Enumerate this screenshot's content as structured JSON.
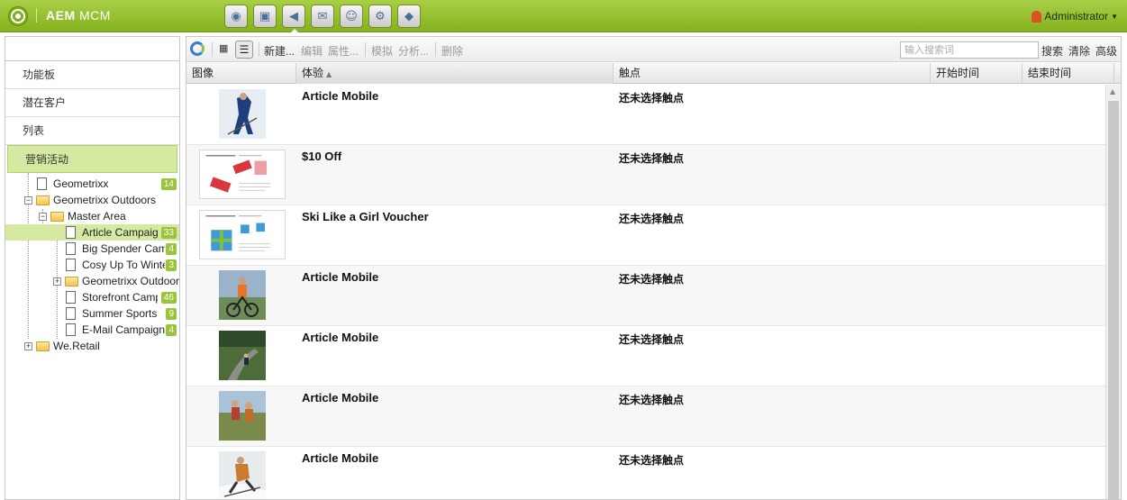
{
  "header": {
    "brand_bold": "AEM",
    "brand_light": "MCM",
    "apps": [
      {
        "name": "globe-icon",
        "glyph": "◉"
      },
      {
        "name": "camera-icon",
        "glyph": "▣"
      },
      {
        "name": "megaphone-icon",
        "glyph": "◀"
      },
      {
        "name": "mail-icon",
        "glyph": "✉"
      },
      {
        "name": "people-icon",
        "glyph": "☺"
      },
      {
        "name": "gear-icon",
        "glyph": "⚙"
      },
      {
        "name": "tag-icon",
        "glyph": "◆"
      }
    ],
    "user": "Administrator"
  },
  "sidebar": {
    "nav": [
      {
        "label": "功能板"
      },
      {
        "label": "潜在客户"
      },
      {
        "label": "列表"
      },
      {
        "label": "营销活动"
      }
    ],
    "tree": [
      {
        "label": "Geometrixx",
        "badge": "14"
      },
      {
        "label": "Geometrixx Outdoors"
      },
      {
        "label": "Master Area"
      },
      {
        "label": "Article Campaign",
        "badge": "33"
      },
      {
        "label": "Big Spender Campaign",
        "badge": "4"
      },
      {
        "label": "Cosy Up To Winter",
        "badge": "3"
      },
      {
        "label": "Geometrixx Outdoors"
      },
      {
        "label": "Storefront Campaign",
        "badge": "46"
      },
      {
        "label": "Summer Sports",
        "badge": "9"
      },
      {
        "label": "E-Mail Campaigns",
        "badge": "4"
      },
      {
        "label": "We.Retail"
      }
    ]
  },
  "toolbar": {
    "new": "新建...",
    "edit": "编辑",
    "props": "属性...",
    "simulate": "模拟",
    "analyze": "分析...",
    "delete": "删除",
    "search_placeholder": "输入搜索词",
    "search": "搜索",
    "clear": "清除",
    "advanced": "高级"
  },
  "columns": {
    "image": "图像",
    "experience": "体验",
    "touchpoint": "触点",
    "start": "开始时间",
    "end": "结束时间"
  },
  "rows": [
    {
      "title": "Article Mobile",
      "touchpoint": "还未选择触点"
    },
    {
      "title": "$10 Off",
      "touchpoint": "还未选择触点"
    },
    {
      "title": "Ski Like a Girl Voucher",
      "touchpoint": "还未选择触点"
    },
    {
      "title": "Article Mobile",
      "touchpoint": "还未选择触点"
    },
    {
      "title": "Article Mobile",
      "touchpoint": "还未选择触点"
    },
    {
      "title": "Article Mobile",
      "touchpoint": "还未选择触点"
    },
    {
      "title": "Article Mobile",
      "touchpoint": "还未选择触点"
    }
  ],
  "colors": {
    "accent": "#9ac43a",
    "selection": "#d5eaa0"
  }
}
